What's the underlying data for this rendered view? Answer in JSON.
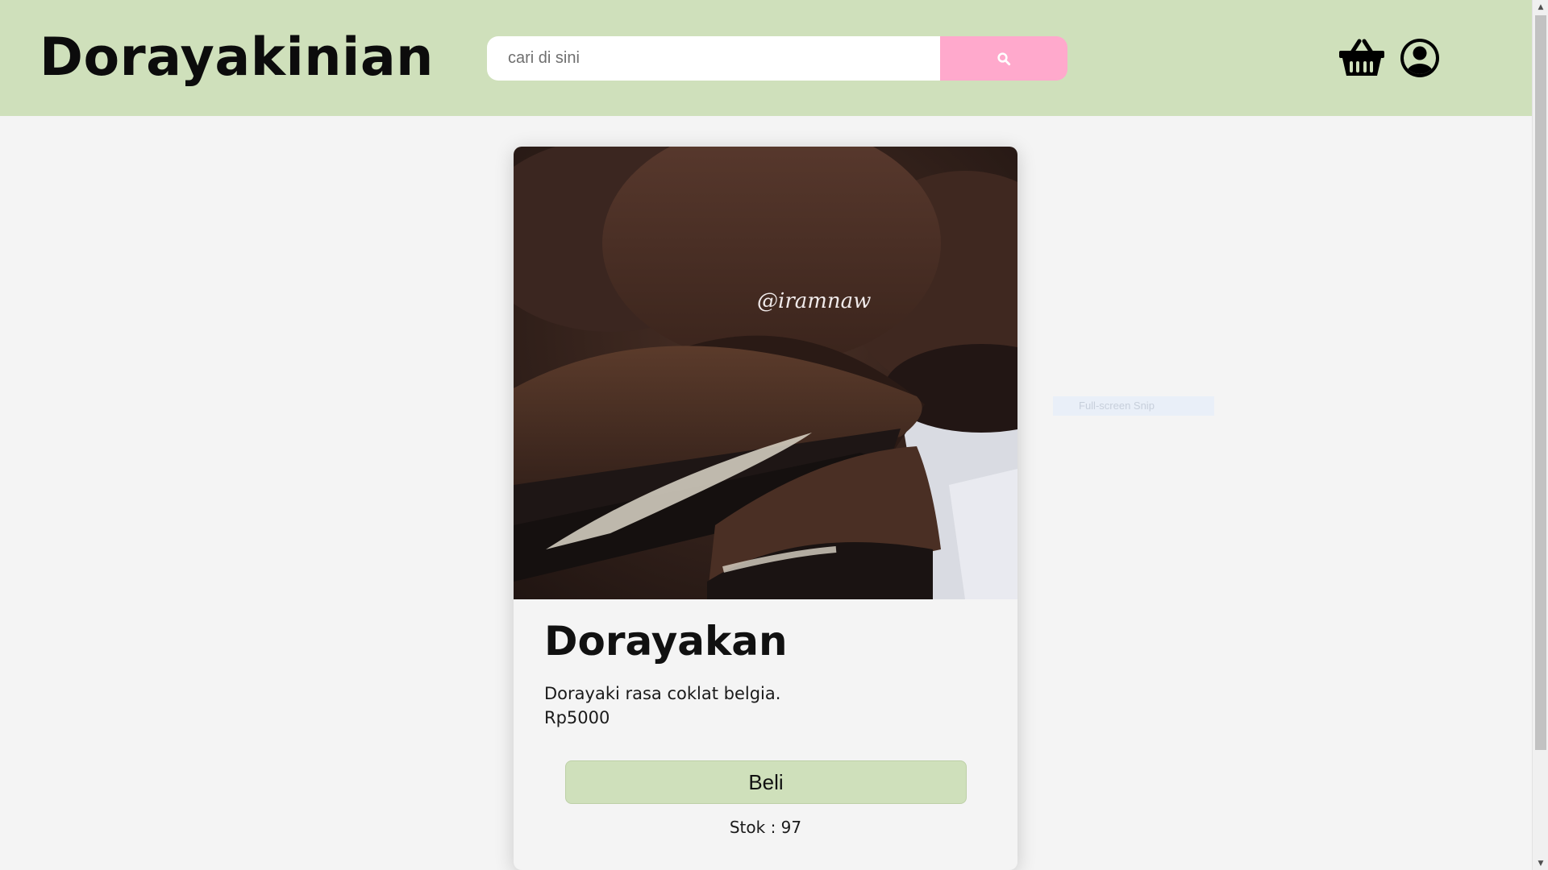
{
  "header": {
    "brand": "Dorayakinian",
    "search_placeholder": "cari di sini",
    "search_icon": "search-icon",
    "cart_icon": "basket-icon",
    "account_icon": "user-circle-icon",
    "background_color": "#cfe0bb",
    "search_button_color": "#ffa9cc"
  },
  "product": {
    "image_watermark": "@iramnaw",
    "name": "Dorayakan",
    "description": "Dorayaki rasa coklat belgia.",
    "price": "Rp5000",
    "buy_label": "Beli",
    "stock_text": "Stok : 97"
  },
  "overlay": {
    "snip_label": "Full-screen Snip"
  }
}
